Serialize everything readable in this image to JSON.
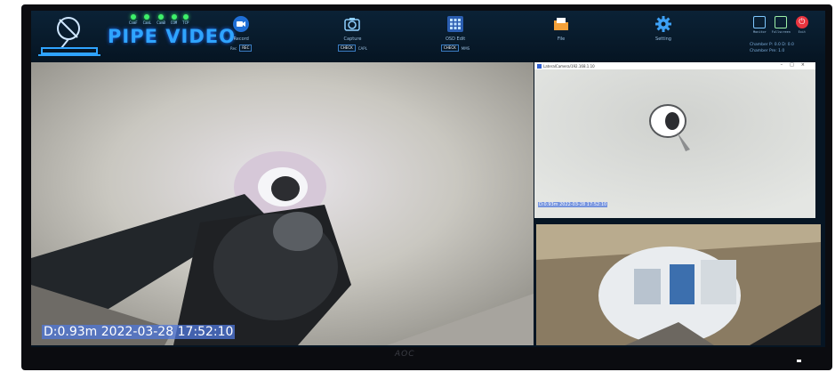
{
  "app": {
    "brand": "PIPE VIDEO",
    "leds": [
      "CamF",
      "CamL",
      "CamB",
      "COM",
      "TCP"
    ]
  },
  "toolbar": {
    "record": {
      "label": "Record",
      "sub_text": "Rec",
      "chip": "REC"
    },
    "capture": {
      "label": "Capture",
      "chip": "CHECK",
      "sub_text": "CAPL"
    },
    "osd": {
      "label": "OSD Edit",
      "chip": "CHECK",
      "sub_text": "MMS"
    },
    "file": {
      "label": "File"
    },
    "setting": {
      "label": "Setting"
    },
    "monitor": {
      "label": "Monitor"
    },
    "fullscreen": {
      "label": "Fullscreen"
    },
    "exit": {
      "label": "Exit"
    },
    "chamber_lines": [
      "Chamber P: 0.0  D: 0.0",
      "Chamber Pre: 1.0"
    ]
  },
  "main_view": {
    "osd": "D:0.93m   2022-03-28 17:52:10"
  },
  "camera_window": {
    "title": "LateralCamera/192.168.1.10",
    "osd": "D:0.93m   2022-03-28 17:52:10"
  },
  "monitor": {
    "brand": "AOC"
  }
}
